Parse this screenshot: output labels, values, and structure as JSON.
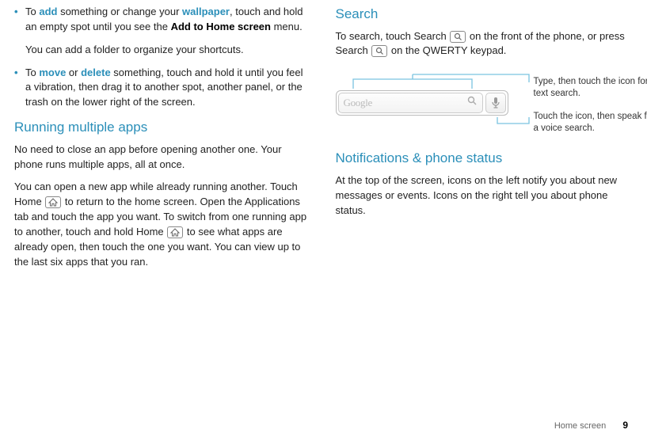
{
  "left": {
    "bullet1": {
      "pre": "To ",
      "kw1": "add",
      "mid1": " something or change your ",
      "kw2": "wallpaper",
      "mid2": ", touch and hold an empty spot until you see the ",
      "bold": "Add to Home screen",
      "post": " menu."
    },
    "bullet1_sub": "You can add a folder to organize your shortcuts.",
    "bullet2": {
      "pre": "To ",
      "kw1": "move",
      "mid1": " or ",
      "kw2": "delete",
      "post": " something, touch and hold it until you feel a vibration, then drag it to another spot, another panel, or the trash on the lower right of the screen."
    },
    "heading": "Running multiple apps",
    "p1": "No need to close an app before opening another one. Your phone runs multiple apps, all at once.",
    "p2a": "You can open a new app while already running another. Touch Home ",
    "p2b": " to return to the home screen. Open the Applications tab and touch the app you want. To switch from one running app to another, touch and hold Home ",
    "p2c": " to see what apps are already open, then touch the one you want. You can view up to the last six apps that you ran."
  },
  "right": {
    "h1": "Search",
    "p1a": "To search, touch Search ",
    "p1b": " on the front of the phone, or press Search ",
    "p1c": " on the QWERTY keypad.",
    "search_placeholder": "Google",
    "callout1": "Type, then touch the icon for a text search.",
    "callout2": "Touch the icon, then speak for a voice search.",
    "h2": "Notifications & phone status",
    "p2": "At the top of the screen, icons on the left notify you about new messages or events. Icons on the right tell you about phone status."
  },
  "footer": {
    "section": "Home screen",
    "page": "9"
  }
}
